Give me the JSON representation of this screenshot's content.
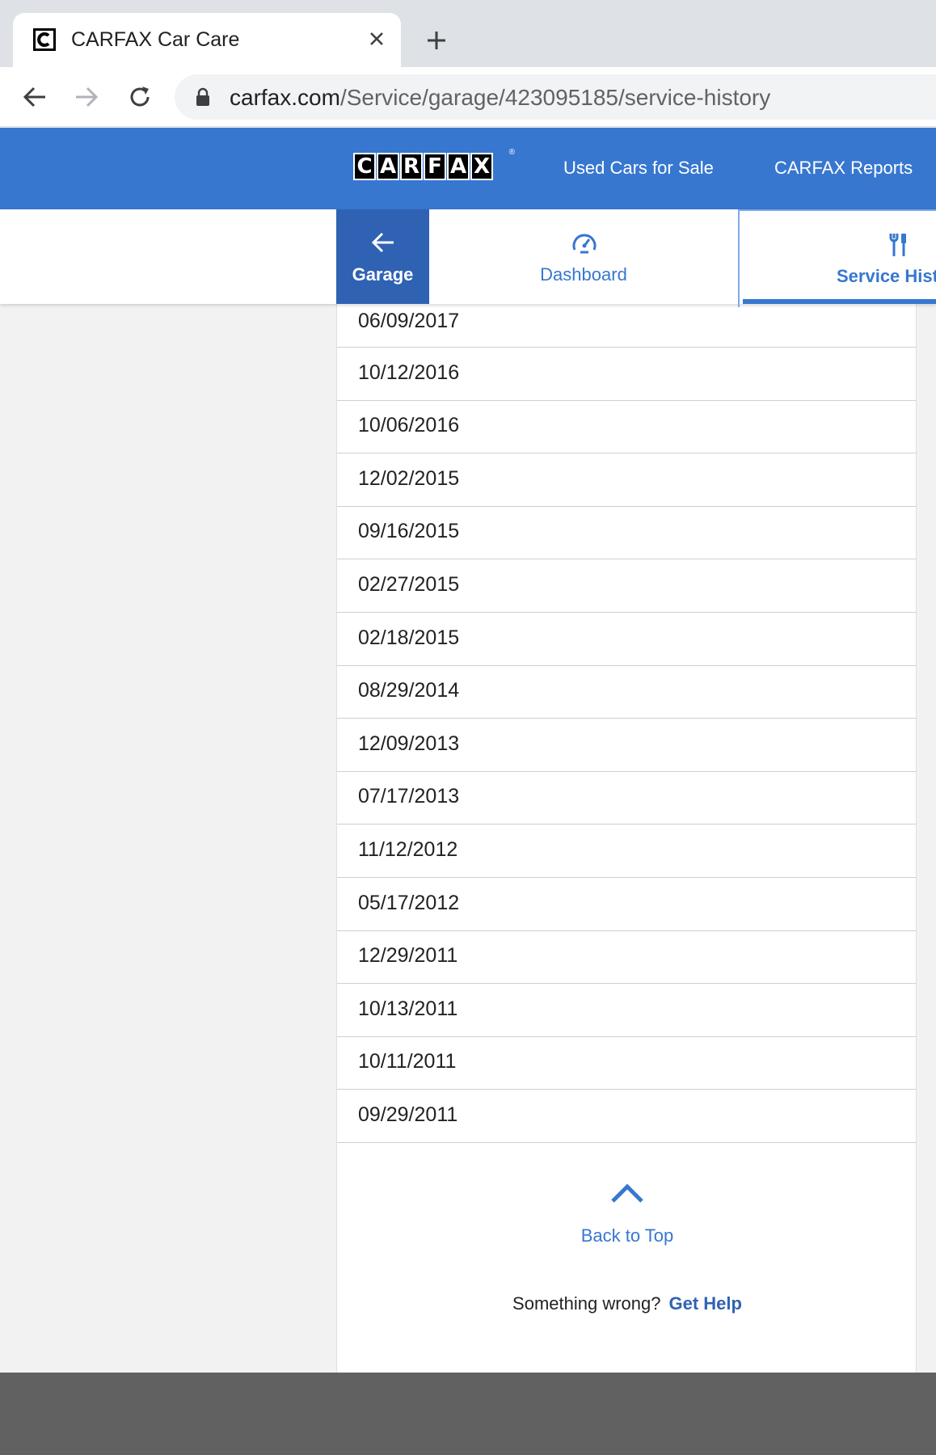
{
  "browser": {
    "tab_title": "CARFAX Car Care",
    "url_host": "carfax.com",
    "url_path": "/Service/garage/423095185/service-history"
  },
  "header": {
    "logo_letters": [
      "C",
      "A",
      "R",
      "F",
      "A",
      "X"
    ],
    "logo_reg": "®",
    "links": [
      "Used Cars for Sale",
      "CARFAX Reports"
    ]
  },
  "subnav": {
    "garage": "Garage",
    "dashboard": "Dashboard",
    "service_history": "Service History"
  },
  "service_dates": [
    "06/09/2017",
    "10/12/2016",
    "10/06/2016",
    "12/02/2015",
    "09/16/2015",
    "02/27/2015",
    "02/18/2015",
    "08/29/2014",
    "12/09/2013",
    "07/17/2013",
    "11/12/2012",
    "05/17/2012",
    "12/29/2011",
    "10/13/2011",
    "10/11/2011",
    "09/29/2011"
  ],
  "footer": {
    "back_to_top": "Back to Top",
    "help_prompt": "Something wrong?",
    "help_link": "Get Help"
  },
  "colors": {
    "brand_blue": "#3777d0",
    "active_blue": "#2f62b3",
    "footer_gray": "#616161"
  }
}
